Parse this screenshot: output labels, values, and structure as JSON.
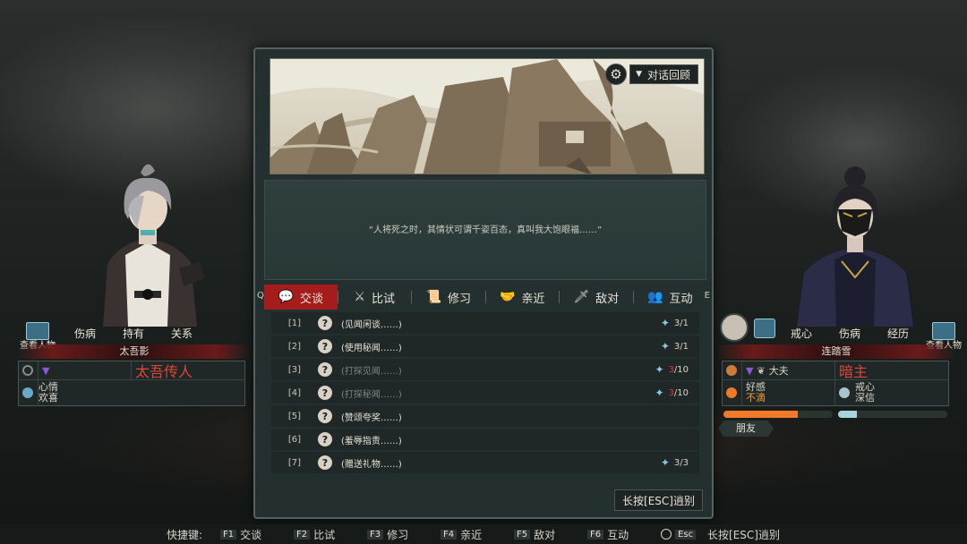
{
  "dialog": {
    "review_button": "对话回顾",
    "quote": "“人将死之时，其情状可谓千姿百态，真叫我大饱眼福……”",
    "tab_key_left": "Q",
    "tab_key_right": "E",
    "tabs": [
      {
        "label": "交谈",
        "icon": "chat-icon",
        "active": true
      },
      {
        "label": "比试",
        "icon": "crossed-swords-icon"
      },
      {
        "label": "修习",
        "icon": "scroll-icon"
      },
      {
        "label": "亲近",
        "icon": "handshake-icon"
      },
      {
        "label": "敌对",
        "icon": "dagger-icon"
      },
      {
        "label": "互动",
        "icon": "people-icon"
      }
    ],
    "options": [
      {
        "num": "[1]",
        "label": "(见闻闲谈……)",
        "cost_current": "3",
        "cost_sep": "/1",
        "cost_full": "3/1",
        "dim": false
      },
      {
        "num": "[2]",
        "label": "(使用秘闻……)",
        "cost_current": "3",
        "cost_sep": "/1",
        "cost_full": "3/1",
        "dim": false
      },
      {
        "num": "[3]",
        "label": "(打探见闻……)",
        "cost_current": "3",
        "cost_sep": "/10",
        "dim": true
      },
      {
        "num": "[4]",
        "label": "(打探秘闻……)",
        "cost_current": "3",
        "cost_sep": "/10",
        "dim": true
      },
      {
        "num": "[5]",
        "label": "(赞颂夸奖……)",
        "dim": false
      },
      {
        "num": "[6]",
        "label": "(羞辱指责……)",
        "dim": false
      },
      {
        "num": "[7]",
        "label": "(赠送礼物……)",
        "cost_full": "3/3",
        "dim": false
      }
    ],
    "flee_button": "长按[ESC]逍别"
  },
  "left_panel": {
    "view_button": "查看人物",
    "tabs": [
      "伤病",
      "持有",
      "关系"
    ],
    "name": "太吾影",
    "identity": "太吾传人",
    "mood_label": "心情",
    "mood_value": "欢喜"
  },
  "right_panel": {
    "view_button": "查看人物",
    "tabs": [
      "戒心",
      "伤病",
      "经历"
    ],
    "name": "连踏雪",
    "profession": "大夫",
    "relation": "暗主",
    "favor_label": "好感",
    "favor_value": "不滴",
    "vigilance_label": "戒心",
    "vigilance_value": "深信",
    "favor_level": 0.68,
    "vigilance_level": 0.17,
    "friend_tag": "朋友",
    "colors": {
      "favor": "#f07a2a",
      "vigilance": "#a8d4e0"
    }
  },
  "hotkeys": {
    "label": "快捷键:",
    "items": [
      {
        "key": "F1",
        "label": "交谈"
      },
      {
        "key": "F2",
        "label": "比试"
      },
      {
        "key": "F3",
        "label": "修习"
      },
      {
        "key": "F4",
        "label": "亲近"
      },
      {
        "key": "F5",
        "label": "敌对"
      },
      {
        "key": "F6",
        "label": "互动"
      }
    ],
    "esc_key": "Esc",
    "esc_label": "长按[ESC]逍别"
  },
  "colors": {
    "active_tab": "#a41c1c",
    "accent_red": "#e0443a"
  }
}
